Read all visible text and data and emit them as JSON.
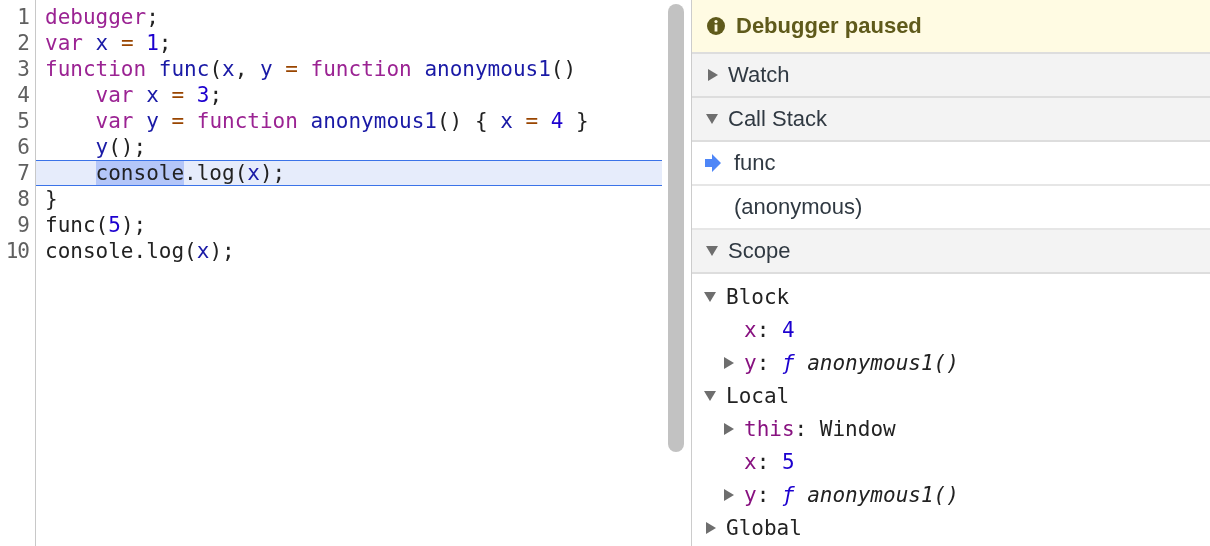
{
  "editor": {
    "lines": [
      {
        "number": "1",
        "current": false,
        "tokens": [
          {
            "t": "debugger",
            "color": "#9b2393"
          },
          {
            "t": ";",
            "color": "#222222"
          }
        ]
      },
      {
        "number": "2",
        "current": false,
        "tokens": [
          {
            "t": "var ",
            "color": "#9b2393"
          },
          {
            "t": "x ",
            "color": "#1a1aa6"
          },
          {
            "t": "= ",
            "color": "#994500"
          },
          {
            "t": "1",
            "color": "#1c00cf"
          },
          {
            "t": ";",
            "color": "#222222"
          }
        ]
      },
      {
        "number": "3",
        "current": false,
        "tokens": [
          {
            "t": "function ",
            "color": "#9b2393"
          },
          {
            "t": "func",
            "color": "#1a1aa6"
          },
          {
            "t": "(",
            "color": "#222222"
          },
          {
            "t": "x",
            "color": "#1a1aa6"
          },
          {
            "t": ", ",
            "color": "#222222"
          },
          {
            "t": "y ",
            "color": "#1a1aa6"
          },
          {
            "t": "= ",
            "color": "#994500"
          },
          {
            "t": "function ",
            "color": "#9b2393"
          },
          {
            "t": "anonymous1",
            "color": "#1a1aa6"
          },
          {
            "t": "()",
            "color": "#222222"
          }
        ],
        "children": [
          {
            "number": "4",
            "current": false,
            "tokens": [
              {
                "t": "var ",
                "color": "#9b2393"
              },
              {
                "t": "x ",
                "color": "#1a1aa6"
              },
              {
                "t": "= ",
                "color": "#994500"
              },
              {
                "t": "3",
                "color": "#1c00cf"
              },
              {
                "t": ";",
                "color": "#222222"
              }
            ]
          },
          {
            "number": "5",
            "current": false,
            "tokens": [
              {
                "t": "var ",
                "color": "#9b2393"
              },
              {
                "t": "y ",
                "color": "#1a1aa6"
              },
              {
                "t": "= ",
                "color": "#994500"
              },
              {
                "t": "function ",
                "color": "#9b2393"
              },
              {
                "t": "anonymous1",
                "color": "#1a1aa6"
              },
              {
                "t": "() { ",
                "color": "#222222"
              },
              {
                "t": "x ",
                "color": "#1a1aa6"
              },
              {
                "t": "= ",
                "color": "#994500"
              },
              {
                "t": "4",
                "color": "#1c00cf"
              },
              {
                "t": " }",
                "color": "#222222"
              }
            ]
          },
          {
            "number": "6",
            "current": false,
            "tokens": [
              {
                "t": "y",
                "color": "#1a1aa6"
              },
              {
                "t": "();",
                "color": "#222222"
              }
            ]
          },
          {
            "number": "7",
            "current": true,
            "paused_at": {
              "t": "console",
              "color": "#222222"
            },
            "tokens": [
              {
                "t": ".log(",
                "color": "#222222"
              },
              {
                "t": "x",
                "color": "#1a1aa6"
              },
              {
                "t": ");",
                "color": "#222222"
              }
            ]
          }
        ]
      },
      {
        "number": "8",
        "current": false,
        "tokens": [
          {
            "t": "}",
            "color": "#222222"
          }
        ]
      },
      {
        "number": "9",
        "current": false,
        "tokens": [
          {
            "t": "func(",
            "color": "#222222"
          },
          {
            "t": "5",
            "color": "#1c00cf"
          },
          {
            "t": ");",
            "color": "#222222"
          }
        ]
      },
      {
        "number": "10",
        "current": false,
        "tokens": [
          {
            "t": "console.log(",
            "color": "#222222"
          },
          {
            "t": "x",
            "color": "#1a1aa6"
          },
          {
            "t": ");",
            "color": "#222222"
          }
        ]
      }
    ]
  },
  "banner": {
    "text": "Debugger paused"
  },
  "sections": [
    {
      "title": "Watch",
      "expanded": false
    },
    {
      "title": "Call Stack",
      "expanded": true,
      "frames": [
        {
          "name": "func",
          "selected": true
        },
        {
          "name": "(anonymous)",
          "selected": false
        }
      ]
    },
    {
      "title": "Scope",
      "expanded": true,
      "scopes": [
        {
          "name": "Block",
          "expanded": true,
          "children": [
            {
              "key": "x",
              "sep": ":",
              "kind": "number",
              "value": "4"
            },
            {
              "key": "y",
              "sep": ":",
              "kind": "function",
              "mark": "ƒ",
              "value": "anonymous1()",
              "expanded": false
            }
          ]
        },
        {
          "name": "Local",
          "expanded": true,
          "children": [
            {
              "key": "this",
              "sep": ":",
              "kind": "object",
              "value": "Window",
              "expanded": false
            },
            {
              "key": "x",
              "sep": ":",
              "kind": "number",
              "value": "5"
            },
            {
              "key": "y",
              "sep": ":",
              "kind": "function",
              "mark": "ƒ",
              "value": "anonymous1()",
              "expanded": false
            }
          ]
        },
        {
          "name": "Global",
          "expanded": false
        }
      ]
    }
  ]
}
